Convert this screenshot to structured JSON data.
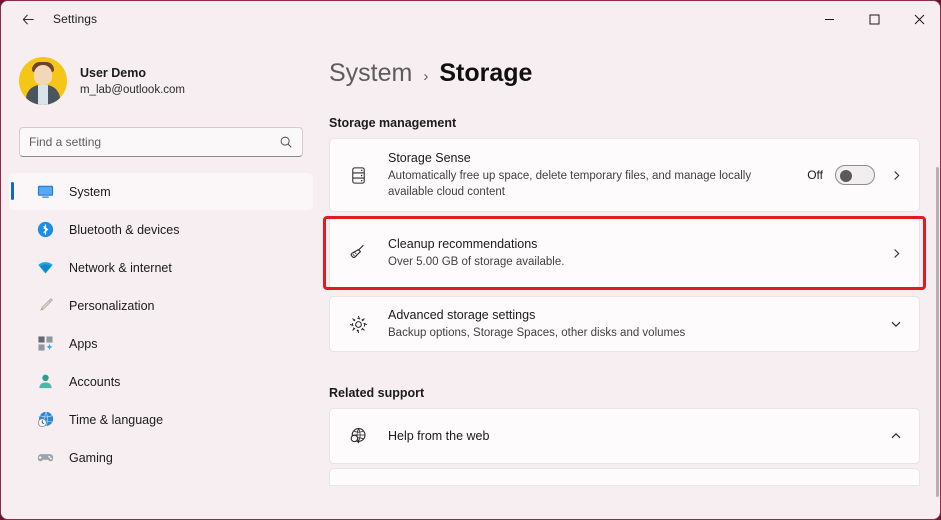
{
  "window": {
    "app_title": "Settings",
    "back_icon": "back-arrow-icon",
    "controls": {
      "minimize": "minimize-icon",
      "maximize": "maximize-icon",
      "close": "close-icon"
    },
    "accent_color": "#0f6cbd",
    "highlight_color": "#e01b24",
    "page_background": "#f7eef1",
    "card_background": "#fdfbfc"
  },
  "sidebar": {
    "account": {
      "name": "User Demo",
      "email": "m_lab@outlook.com",
      "avatar": "user-avatar"
    },
    "search": {
      "placeholder": "Find a setting",
      "value": "",
      "icon": "search-icon"
    },
    "items": [
      {
        "label": "System",
        "icon": "monitor-icon",
        "selected": true
      },
      {
        "label": "Bluetooth & devices",
        "icon": "bluetooth-icon",
        "selected": false
      },
      {
        "label": "Network & internet",
        "icon": "wifi-icon",
        "selected": false
      },
      {
        "label": "Personalization",
        "icon": "paintbrush-icon",
        "selected": false
      },
      {
        "label": "Apps",
        "icon": "apps-icon",
        "selected": false
      },
      {
        "label": "Accounts",
        "icon": "person-icon",
        "selected": false
      },
      {
        "label": "Time & language",
        "icon": "clock-globe-icon",
        "selected": false
      },
      {
        "label": "Gaming",
        "icon": "gamepad-icon",
        "selected": false
      }
    ]
  },
  "main": {
    "breadcrumb": {
      "parent": "System",
      "separator": "›",
      "current": "Storage"
    },
    "storage_management": {
      "heading": "Storage management",
      "cards": [
        {
          "title": "Storage Sense",
          "subtitle": "Automatically free up space, delete temporary files, and manage locally available cloud content",
          "icon": "drive-stack-icon",
          "toggle_label": "Off",
          "toggle_state": "off",
          "chevron": "chevron-right-icon"
        },
        {
          "title": "Cleanup recommendations",
          "subtitle": "Over 5.00 GB of storage available.",
          "icon": "broom-icon",
          "chevron": "chevron-right-icon",
          "highlighted": true
        },
        {
          "title": "Advanced storage settings",
          "subtitle": "Backup options, Storage Spaces, other disks and volumes",
          "icon": "gear-icon",
          "chevron": "chevron-down-icon"
        }
      ]
    },
    "related_support": {
      "heading": "Related support",
      "cards": [
        {
          "title": "Help from the web",
          "icon": "globe-search-icon",
          "chevron": "chevron-up-icon"
        }
      ]
    }
  }
}
